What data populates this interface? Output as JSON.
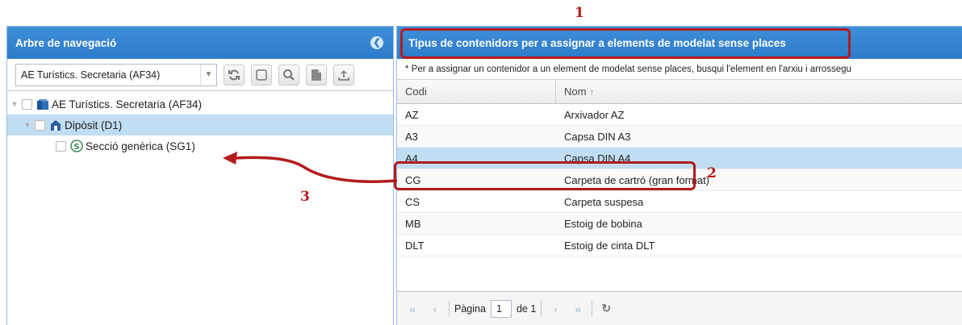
{
  "annotations": {
    "n1": "1",
    "n2": "2",
    "n3": "3"
  },
  "left": {
    "title": "Arbre de navegació",
    "combo_value": "AE Turístics. Secretaria (AF34)",
    "tree": [
      {
        "label": "AE Turístics. Secretaria (AF34)"
      },
      {
        "label": "Dipòsit (D1)"
      },
      {
        "label": "Secció genèrica (SG1)"
      }
    ]
  },
  "right": {
    "title": "Tipus de contenidors per a assignar a elements de modelat sense places",
    "info": "* Per a assignar un contenidor a un element de modelat sense places, busqui l'element en l'arxiu i arrossegu",
    "columns": {
      "codi": "Codi",
      "nom": "Nom"
    },
    "rows": [
      {
        "codi": "AZ",
        "nom": "Arxivador AZ"
      },
      {
        "codi": "A3",
        "nom": "Capsa DIN A3"
      },
      {
        "codi": "A4",
        "nom": "Capsa DIN A4"
      },
      {
        "codi": "CG",
        "nom": "Carpeta de cartró (gran format)"
      },
      {
        "codi": "CS",
        "nom": "Carpeta suspesa"
      },
      {
        "codi": "MB",
        "nom": "Estoig de bobina"
      },
      {
        "codi": "DLT",
        "nom": "Estoig de cinta DLT"
      }
    ],
    "pager": {
      "page_label": "Pàgina",
      "page": "1",
      "of_label": "de 1"
    }
  },
  "colors": {
    "accent": "#2c7bc9",
    "annotation": "#b31b1b",
    "selected": "#c1ddf1"
  }
}
